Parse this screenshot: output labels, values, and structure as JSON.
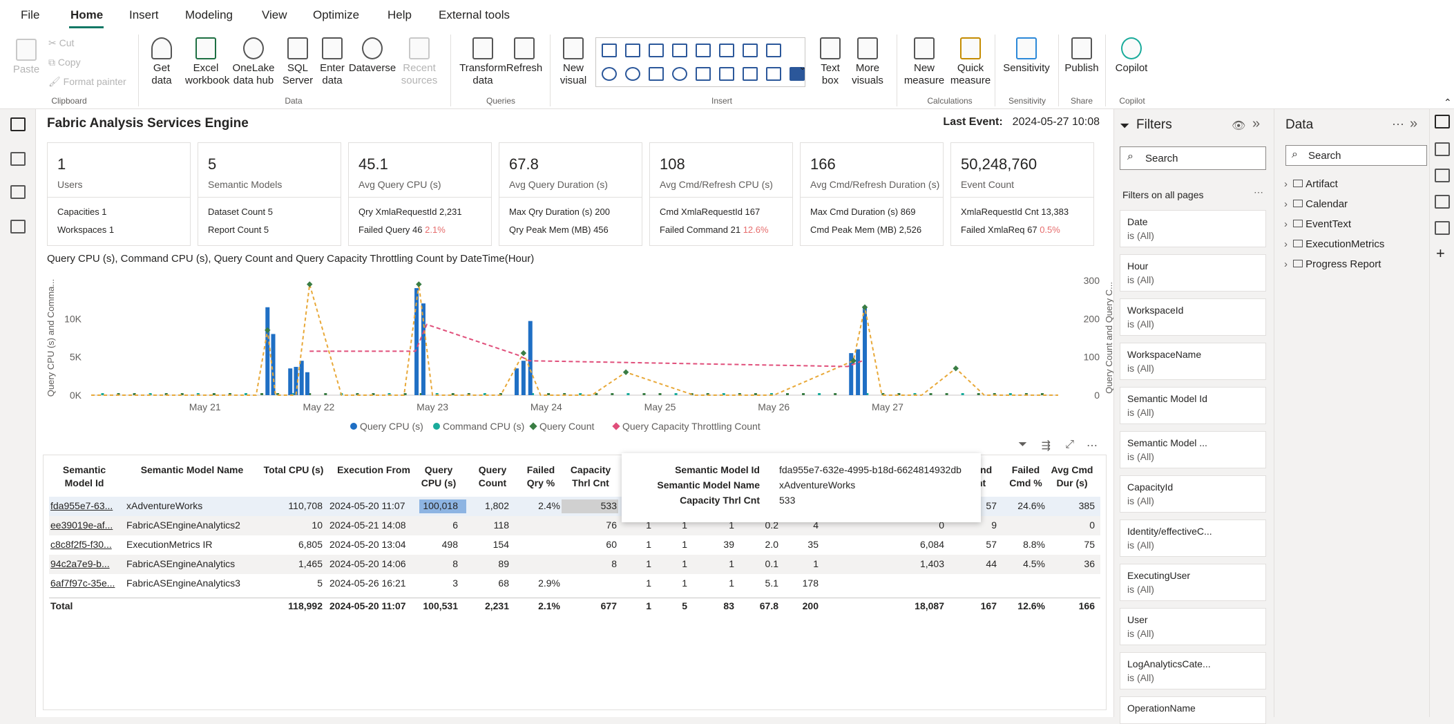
{
  "menu": {
    "items": [
      "File",
      "Home",
      "Insert",
      "Modeling",
      "View",
      "Optimize",
      "Help",
      "External tools"
    ]
  },
  "ribbon": {
    "clipboard": {
      "paste": "Paste",
      "cut": "Cut",
      "copy": "Copy",
      "format_painter": "Format painter",
      "group": "Clipboard"
    },
    "data": {
      "get_data": "Get data",
      "excel": "Excel workbook",
      "onelake": "OneLake data hub",
      "sql": "SQL Server",
      "enter": "Enter data",
      "dataverse": "Dataverse",
      "recent": "Recent sources",
      "group": "Data"
    },
    "queries": {
      "transform": "Transform data",
      "refresh": "Refresh",
      "group": "Queries"
    },
    "insert": {
      "new_visual": "New visual",
      "text_box": "Text box",
      "more_visuals": "More visuals",
      "group": "Insert"
    },
    "calculations": {
      "new_measure": "New measure",
      "quick_measure": "Quick measure",
      "group": "Calculations"
    },
    "sensitivity": {
      "label": "Sensitivity",
      "group": "Sensitivity"
    },
    "share": {
      "publish": "Publish",
      "group": "Share"
    },
    "copilot": {
      "label": "Copilot",
      "group": "Copilot"
    }
  },
  "report": {
    "title": "Fabric Analysis Services Engine",
    "last_event_label": "Last Event:",
    "last_event_value": "2024-05-27 10:08"
  },
  "cards": [
    {
      "value": "1",
      "label": "Users",
      "s1": "Capacities 1",
      "s2": "Workspaces 1",
      "s2red": ""
    },
    {
      "value": "5",
      "label": "Semantic Models",
      "s1": "Dataset Count 5",
      "s2": "Report Count 5",
      "s2red": ""
    },
    {
      "value": "45.1",
      "label": "Avg Query CPU (s)",
      "s1": "Qry XmlaRequestId 2,231",
      "s2": "Failed Query 46",
      "s2red": "2.1%"
    },
    {
      "value": "67.8",
      "label": "Avg Query Duration (s)",
      "s1": "Max Qry Duration (s) 200",
      "s2": "Qry Peak Mem (MB) 456",
      "s2red": ""
    },
    {
      "value": "108",
      "label": "Avg Cmd/Refresh CPU (s)",
      "s1": "Cmd XmlaRequestId 167",
      "s2": "Failed Command 21",
      "s2red": "12.6%"
    },
    {
      "value": "166",
      "label": "Avg Cmd/Refresh Duration (s)",
      "s1": "Max Cmd Duration (s) 869",
      "s2": "Cmd Peak Mem (MB) 2,526",
      "s2red": ""
    },
    {
      "value": "50,248,760",
      "label": "Event Count",
      "s1": "XmlaRequestId Cnt 13,383",
      "s2": "Failed XmlaReq 67",
      "s2red": "0.5%"
    }
  ],
  "chart_data": {
    "type": "bar",
    "title": "Query CPU (s), Command CPU (s), Query Count and Query Capacity Throttling Count by DateTime(Hour)",
    "ylabel": "Query CPU (s) and Comma...",
    "y2label": "Query Count and Query C...",
    "ylim": [
      0,
      15000
    ],
    "y2lim": [
      0,
      300
    ],
    "yticks": [
      "0K",
      "5K",
      "10K"
    ],
    "y2ticks": [
      "0",
      "100",
      "200",
      "300"
    ],
    "xticks": [
      "May 21",
      "May 22",
      "May 23",
      "May 24",
      "May 25",
      "May 26",
      "May 27"
    ],
    "legend": [
      "Query CPU (s)",
      "Command CPU (s)",
      "Query Count",
      "Query Capacity Throttling Count"
    ],
    "colors": {
      "query_cpu": "#1f6fc4",
      "command_cpu": "#1aab9b",
      "query_count": "#e8a838",
      "throttling": "#e04e7a",
      "marker": "#3a7d44"
    },
    "bars": [
      {
        "x": 1.55,
        "value": 11500
      },
      {
        "x": 1.6,
        "value": 8000
      },
      {
        "x": 1.75,
        "value": 3500
      },
      {
        "x": 1.8,
        "value": 3700
      },
      {
        "x": 1.85,
        "value": 4500
      },
      {
        "x": 1.9,
        "value": 3000
      },
      {
        "x": 2.86,
        "value": 14000
      },
      {
        "x": 2.92,
        "value": 12000
      },
      {
        "x": 3.74,
        "value": 3500
      },
      {
        "x": 3.8,
        "value": 4500
      },
      {
        "x": 3.86,
        "value": 9700
      },
      {
        "x": 6.68,
        "value": 5500
      },
      {
        "x": 6.74,
        "value": 6000
      },
      {
        "x": 6.8,
        "value": 11500
      }
    ],
    "query_count": [
      {
        "x": 0.0,
        "value": 0
      },
      {
        "x": 1.45,
        "value": 0
      },
      {
        "x": 1.55,
        "value": 170
      },
      {
        "x": 1.62,
        "value": 0
      },
      {
        "x": 1.8,
        "value": 0
      },
      {
        "x": 1.92,
        "value": 290
      },
      {
        "x": 2.2,
        "value": 0
      },
      {
        "x": 2.75,
        "value": 0
      },
      {
        "x": 2.88,
        "value": 290
      },
      {
        "x": 3.0,
        "value": 0
      },
      {
        "x": 3.6,
        "value": 0
      },
      {
        "x": 3.8,
        "value": 110
      },
      {
        "x": 3.95,
        "value": 0
      },
      {
        "x": 4.4,
        "value": 0
      },
      {
        "x": 4.7,
        "value": 60
      },
      {
        "x": 5.3,
        "value": 0
      },
      {
        "x": 6.0,
        "value": 0
      },
      {
        "x": 6.7,
        "value": 90
      },
      {
        "x": 6.8,
        "value": 230
      },
      {
        "x": 6.95,
        "value": 0
      },
      {
        "x": 7.3,
        "value": 0
      },
      {
        "x": 7.6,
        "value": 70
      },
      {
        "x": 7.85,
        "value": 0
      },
      {
        "x": 8.5,
        "value": 0
      }
    ],
    "throttling": [
      {
        "x": 1.92,
        "value": 115
      },
      {
        "x": 2.85,
        "value": 115
      },
      {
        "x": 2.95,
        "value": 185
      },
      {
        "x": 3.75,
        "value": 105
      },
      {
        "x": 3.85,
        "value": 90
      },
      {
        "x": 6.65,
        "value": 75
      },
      {
        "x": 6.78,
        "value": 90
      }
    ]
  },
  "table": {
    "headers": [
      "Semantic Model Id",
      "Semantic Model Name",
      "Total CPU (s)",
      "Execution From",
      "Query CPU (s)",
      "Query Count",
      "Failed Qry %",
      "Capacity Thrl Cnt",
      "ommand Count",
      "Failed Cmd %",
      "Avg Cmd Dur (s)"
    ],
    "rows": [
      {
        "id": "fda955e7-63...",
        "name": "xAdventureWorks",
        "total_cpu": "110,708",
        "from": "2024-05-20 11:07",
        "qcpu": "100,018",
        "qcount": "1,802",
        "fqry": "2.4%",
        "thrl": "533",
        "c1": "",
        "c2": "",
        "c3": "",
        "c4": "",
        "c5": "",
        "cmdcpu": "",
        "cmdcount": "57",
        "fcmd": "24.6%",
        "avgcmd": "385"
      },
      {
        "id": "ee39019e-af...",
        "name": "FabricASEngineAnalytics2",
        "total_cpu": "10",
        "from": "2024-05-21 14:08",
        "qcpu": "6",
        "qcount": "118",
        "fqry": "",
        "thrl": "76",
        "c1": "1",
        "c2": "1",
        "c3": "1",
        "c4": "0.2",
        "c5": "4",
        "cmdcpu": "0",
        "cmdcount": "9",
        "fcmd": "",
        "avgcmd": "0"
      },
      {
        "id": "c8c8f2f5-f30...",
        "name": "ExecutionMetrics IR",
        "total_cpu": "6,805",
        "from": "2024-05-20 13:04",
        "qcpu": "498",
        "qcount": "154",
        "fqry": "",
        "thrl": "60",
        "c1": "1",
        "c2": "1",
        "c3": "39",
        "c4": "2.0",
        "c5": "35",
        "cmdcpu": "6,084",
        "cmdcount": "57",
        "fcmd": "8.8%",
        "avgcmd": "75"
      },
      {
        "id": "94c2a7e9-b...",
        "name": "FabricASEngineAnalytics",
        "total_cpu": "1,465",
        "from": "2024-05-20 14:06",
        "qcpu": "8",
        "qcount": "89",
        "fqry": "",
        "thrl": "8",
        "c1": "1",
        "c2": "1",
        "c3": "1",
        "c4": "0.1",
        "c5": "1",
        "cmdcpu": "1,403",
        "cmdcount": "44",
        "fcmd": "4.5%",
        "avgcmd": "36"
      },
      {
        "id": "6af7f97c-35e...",
        "name": "FabricASEngineAnalytics3",
        "total_cpu": "5",
        "from": "2024-05-26 16:21",
        "qcpu": "3",
        "qcount": "68",
        "fqry": "2.9%",
        "thrl": "",
        "c1": "1",
        "c2": "1",
        "c3": "1",
        "c4": "5.1",
        "c5": "178",
        "cmdcpu": "",
        "cmdcount": "",
        "fcmd": "",
        "avgcmd": ""
      }
    ],
    "total": {
      "id": "Total",
      "name": "",
      "total_cpu": "118,992",
      "from": "2024-05-20 11:07",
      "qcpu": "100,531",
      "qcount": "2,231",
      "fqry": "2.1%",
      "thrl": "677",
      "c1": "1",
      "c2": "5",
      "c3": "83",
      "c4": "67.8",
      "c5": "200",
      "cmdcpu": "18,087",
      "cmdcount": "167",
      "fcmd": "12.6%",
      "avgcmd": "166"
    }
  },
  "tooltip": {
    "k1": "Semantic Model Id",
    "v1": "fda955e7-632e-4995-b18d-6624814932db",
    "k2": "Semantic Model Name",
    "v2": "xAdventureWorks",
    "k3": "Capacity Thrl Cnt",
    "v3": "533"
  },
  "filters": {
    "title": "Filters",
    "search_placeholder": "Search",
    "section": "Filters on all pages",
    "items": [
      {
        "name": "Date",
        "value": "is (All)"
      },
      {
        "name": "Hour",
        "value": "is (All)"
      },
      {
        "name": "WorkspaceId",
        "value": "is (All)"
      },
      {
        "name": "WorkspaceName",
        "value": "is (All)"
      },
      {
        "name": "Semantic Model Id",
        "value": "is (All)"
      },
      {
        "name": "Semantic Model ...",
        "value": "is (All)"
      },
      {
        "name": "CapacityId",
        "value": "is (All)"
      },
      {
        "name": "Identity/effectiveC...",
        "value": "is (All)"
      },
      {
        "name": "ExecutingUser",
        "value": "is (All)"
      },
      {
        "name": "User",
        "value": "is (All)"
      },
      {
        "name": "LogAnalyticsCate...",
        "value": "is (All)"
      },
      {
        "name": "OperationName",
        "value": ""
      }
    ]
  },
  "data_pane": {
    "title": "Data",
    "search_placeholder": "Search",
    "tables": [
      "Artifact",
      "Calendar",
      "EventText",
      "ExecutionMetrics",
      "Progress Report"
    ]
  }
}
